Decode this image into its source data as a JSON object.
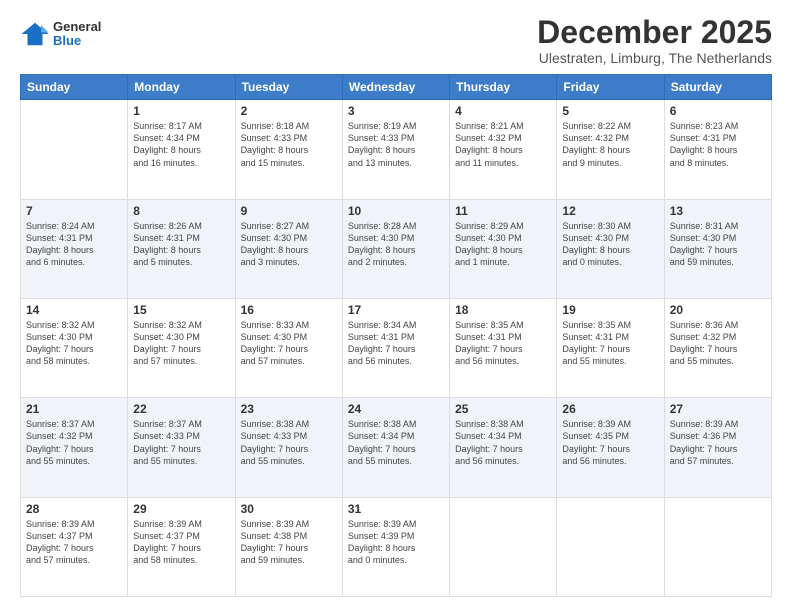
{
  "header": {
    "logo_general": "General",
    "logo_blue": "Blue",
    "month_title": "December 2025",
    "location": "Ulestraten, Limburg, The Netherlands"
  },
  "weekdays": [
    "Sunday",
    "Monday",
    "Tuesday",
    "Wednesday",
    "Thursday",
    "Friday",
    "Saturday"
  ],
  "weeks": [
    [
      {
        "day": "",
        "info": ""
      },
      {
        "day": "1",
        "info": "Sunrise: 8:17 AM\nSunset: 4:34 PM\nDaylight: 8 hours\nand 16 minutes."
      },
      {
        "day": "2",
        "info": "Sunrise: 8:18 AM\nSunset: 4:33 PM\nDaylight: 8 hours\nand 15 minutes."
      },
      {
        "day": "3",
        "info": "Sunrise: 8:19 AM\nSunset: 4:33 PM\nDaylight: 8 hours\nand 13 minutes."
      },
      {
        "day": "4",
        "info": "Sunrise: 8:21 AM\nSunset: 4:32 PM\nDaylight: 8 hours\nand 11 minutes."
      },
      {
        "day": "5",
        "info": "Sunrise: 8:22 AM\nSunset: 4:32 PM\nDaylight: 8 hours\nand 9 minutes."
      },
      {
        "day": "6",
        "info": "Sunrise: 8:23 AM\nSunset: 4:31 PM\nDaylight: 8 hours\nand 8 minutes."
      }
    ],
    [
      {
        "day": "7",
        "info": "Sunrise: 8:24 AM\nSunset: 4:31 PM\nDaylight: 8 hours\nand 6 minutes."
      },
      {
        "day": "8",
        "info": "Sunrise: 8:26 AM\nSunset: 4:31 PM\nDaylight: 8 hours\nand 5 minutes."
      },
      {
        "day": "9",
        "info": "Sunrise: 8:27 AM\nSunset: 4:30 PM\nDaylight: 8 hours\nand 3 minutes."
      },
      {
        "day": "10",
        "info": "Sunrise: 8:28 AM\nSunset: 4:30 PM\nDaylight: 8 hours\nand 2 minutes."
      },
      {
        "day": "11",
        "info": "Sunrise: 8:29 AM\nSunset: 4:30 PM\nDaylight: 8 hours\nand 1 minute."
      },
      {
        "day": "12",
        "info": "Sunrise: 8:30 AM\nSunset: 4:30 PM\nDaylight: 8 hours\nand 0 minutes."
      },
      {
        "day": "13",
        "info": "Sunrise: 8:31 AM\nSunset: 4:30 PM\nDaylight: 7 hours\nand 59 minutes."
      }
    ],
    [
      {
        "day": "14",
        "info": "Sunrise: 8:32 AM\nSunset: 4:30 PM\nDaylight: 7 hours\nand 58 minutes."
      },
      {
        "day": "15",
        "info": "Sunrise: 8:32 AM\nSunset: 4:30 PM\nDaylight: 7 hours\nand 57 minutes."
      },
      {
        "day": "16",
        "info": "Sunrise: 8:33 AM\nSunset: 4:30 PM\nDaylight: 7 hours\nand 57 minutes."
      },
      {
        "day": "17",
        "info": "Sunrise: 8:34 AM\nSunset: 4:31 PM\nDaylight: 7 hours\nand 56 minutes."
      },
      {
        "day": "18",
        "info": "Sunrise: 8:35 AM\nSunset: 4:31 PM\nDaylight: 7 hours\nand 56 minutes."
      },
      {
        "day": "19",
        "info": "Sunrise: 8:35 AM\nSunset: 4:31 PM\nDaylight: 7 hours\nand 55 minutes."
      },
      {
        "day": "20",
        "info": "Sunrise: 8:36 AM\nSunset: 4:32 PM\nDaylight: 7 hours\nand 55 minutes."
      }
    ],
    [
      {
        "day": "21",
        "info": "Sunrise: 8:37 AM\nSunset: 4:32 PM\nDaylight: 7 hours\nand 55 minutes."
      },
      {
        "day": "22",
        "info": "Sunrise: 8:37 AM\nSunset: 4:33 PM\nDaylight: 7 hours\nand 55 minutes."
      },
      {
        "day": "23",
        "info": "Sunrise: 8:38 AM\nSunset: 4:33 PM\nDaylight: 7 hours\nand 55 minutes."
      },
      {
        "day": "24",
        "info": "Sunrise: 8:38 AM\nSunset: 4:34 PM\nDaylight: 7 hours\nand 55 minutes."
      },
      {
        "day": "25",
        "info": "Sunrise: 8:38 AM\nSunset: 4:34 PM\nDaylight: 7 hours\nand 56 minutes."
      },
      {
        "day": "26",
        "info": "Sunrise: 8:39 AM\nSunset: 4:35 PM\nDaylight: 7 hours\nand 56 minutes."
      },
      {
        "day": "27",
        "info": "Sunrise: 8:39 AM\nSunset: 4:36 PM\nDaylight: 7 hours\nand 57 minutes."
      }
    ],
    [
      {
        "day": "28",
        "info": "Sunrise: 8:39 AM\nSunset: 4:37 PM\nDaylight: 7 hours\nand 57 minutes."
      },
      {
        "day": "29",
        "info": "Sunrise: 8:39 AM\nSunset: 4:37 PM\nDaylight: 7 hours\nand 58 minutes."
      },
      {
        "day": "30",
        "info": "Sunrise: 8:39 AM\nSunset: 4:38 PM\nDaylight: 7 hours\nand 59 minutes."
      },
      {
        "day": "31",
        "info": "Sunrise: 8:39 AM\nSunset: 4:39 PM\nDaylight: 8 hours\nand 0 minutes."
      },
      {
        "day": "",
        "info": ""
      },
      {
        "day": "",
        "info": ""
      },
      {
        "day": "",
        "info": ""
      }
    ]
  ]
}
